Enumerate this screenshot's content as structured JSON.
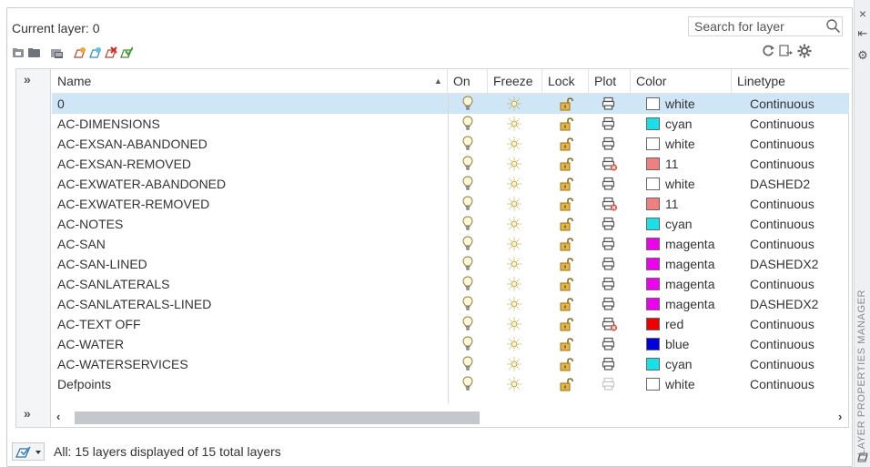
{
  "current_layer": "Current layer: 0",
  "search": {
    "placeholder": "Search for layer"
  },
  "expander_chevrons": {
    "top": "»",
    "bottom": "»"
  },
  "columns": {
    "name": "Name",
    "on": "On",
    "freeze": "Freeze",
    "lock": "Lock",
    "plot": "Plot",
    "color": "Color",
    "linetype": "Linetype"
  },
  "layers": [
    {
      "name": "0",
      "color": "white",
      "color_hex": "#ffffff",
      "linetype": "Continuous",
      "plot": "on",
      "selected": true
    },
    {
      "name": "AC-DIMENSIONS",
      "color": "cyan",
      "color_hex": "#19e0e6",
      "linetype": "Continuous",
      "plot": "on"
    },
    {
      "name": "AC-EXSAN-ABANDONED",
      "color": "white",
      "color_hex": "#ffffff",
      "linetype": "Continuous",
      "plot": "on"
    },
    {
      "name": "AC-EXSAN-REMOVED",
      "color": "11",
      "color_hex": "#f08080",
      "linetype": "Continuous",
      "plot": "off"
    },
    {
      "name": "AC-EXWATER-ABANDONED",
      "color": "white",
      "color_hex": "#ffffff",
      "linetype": "DASHED2",
      "plot": "on"
    },
    {
      "name": "AC-EXWATER-REMOVED",
      "color": "11",
      "color_hex": "#f08080",
      "linetype": "Continuous",
      "plot": "off"
    },
    {
      "name": "AC-NOTES",
      "color": "cyan",
      "color_hex": "#19e0e6",
      "linetype": "Continuous",
      "plot": "on"
    },
    {
      "name": "AC-SAN",
      "color": "magenta",
      "color_hex": "#ee00ee",
      "linetype": "Continuous",
      "plot": "on"
    },
    {
      "name": "AC-SAN-LINED",
      "color": "magenta",
      "color_hex": "#ee00ee",
      "linetype": "DASHEDX2",
      "plot": "on"
    },
    {
      "name": "AC-SANLATERALS",
      "color": "magenta",
      "color_hex": "#ee00ee",
      "linetype": "Continuous",
      "plot": "on"
    },
    {
      "name": "AC-SANLATERALS-LINED",
      "color": "magenta",
      "color_hex": "#ee00ee",
      "linetype": "DASHEDX2",
      "plot": "on"
    },
    {
      "name": "AC-TEXT OFF",
      "color": "red",
      "color_hex": "#ee0000",
      "linetype": "Continuous",
      "plot": "off"
    },
    {
      "name": "AC-WATER",
      "color": "blue",
      "color_hex": "#0000dd",
      "linetype": "Continuous",
      "plot": "on"
    },
    {
      "name": "AC-WATERSERVICES",
      "color": "cyan",
      "color_hex": "#19e0e6",
      "linetype": "Continuous",
      "plot": "on"
    },
    {
      "name": "Defpoints",
      "color": "white",
      "color_hex": "#ffffff",
      "linetype": "Continuous",
      "plot": "disabled"
    }
  ],
  "status_text": "All: 15 layers displayed of 15 total layers",
  "side_panel_title": "LAYER PROPERTIES MANAGER",
  "accent": {
    "selected_row": "#cfe6f7",
    "bulb": "#c9b24a",
    "lock": "#c89b28",
    "no_plot": "#e84c3d"
  }
}
